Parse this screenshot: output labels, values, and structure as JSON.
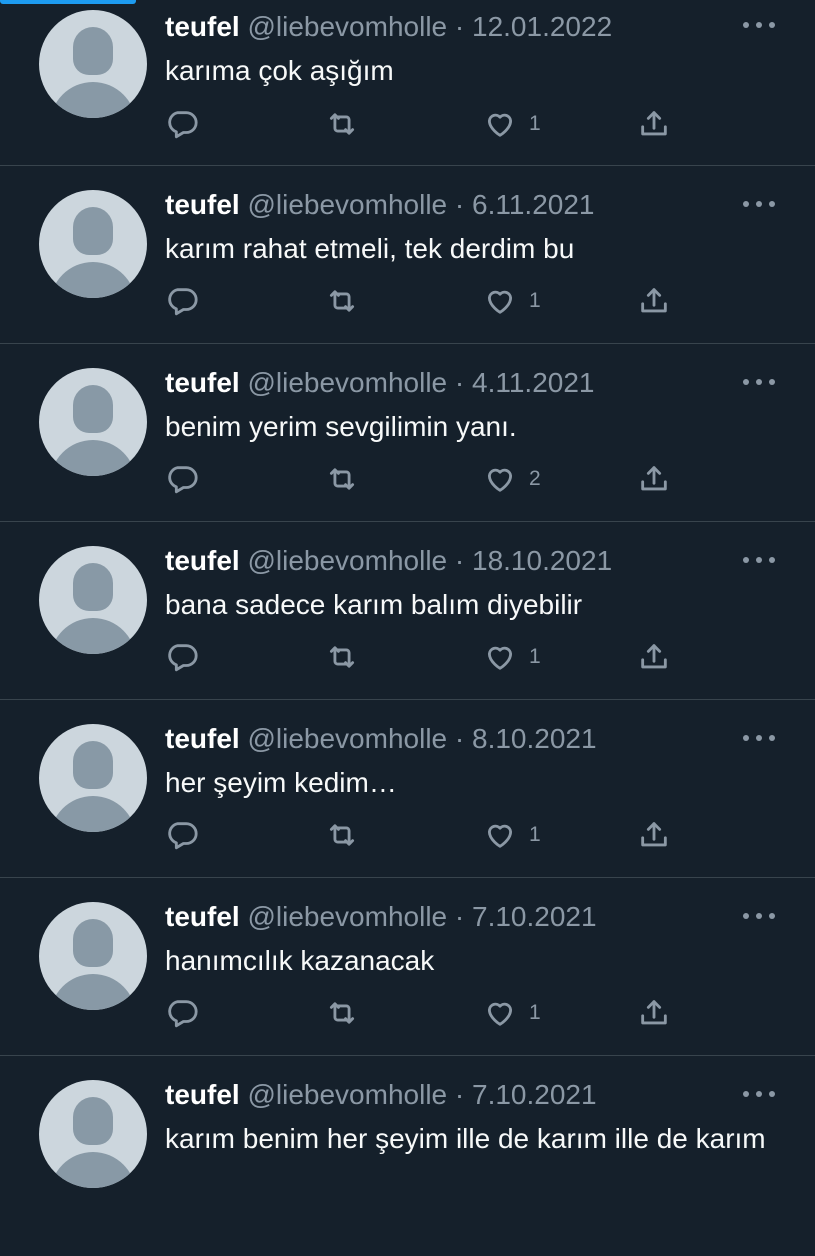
{
  "tweets": [
    {
      "name": "teufel",
      "handle": "@liebevomholle",
      "dot": "·",
      "date": "12.01.2022",
      "text": "karıma çok aşığım",
      "likes": "1"
    },
    {
      "name": "teufel",
      "handle": "@liebevomholle",
      "dot": "·",
      "date": "6.11.2021",
      "text": "karım rahat etmeli, tek derdim bu",
      "likes": "1"
    },
    {
      "name": "teufel",
      "handle": "@liebevomholle",
      "dot": "·",
      "date": "4.11.2021",
      "text": "benim yerim sevgilimin yanı.",
      "likes": "2"
    },
    {
      "name": "teufel",
      "handle": "@liebevomholle",
      "dot": "·",
      "date": "18.10.2021",
      "text": "bana sadece karım balım diyebilir",
      "likes": "1"
    },
    {
      "name": "teufel",
      "handle": "@liebevomholle",
      "dot": "·",
      "date": "8.10.2021",
      "text": "her şeyim kedim…",
      "likes": "1"
    },
    {
      "name": "teufel",
      "handle": "@liebevomholle",
      "dot": "·",
      "date": "7.10.2021",
      "text": "hanımcılık kazanacak",
      "likes": "1"
    },
    {
      "name": "teufel",
      "handle": "@liebevomholle",
      "dot": "·",
      "date": "7.10.2021",
      "text": "karım benim her şeyim ille de karım ille de karım",
      "likes": ""
    }
  ],
  "icons": {
    "reply": "reply-icon",
    "retweet": "retweet-icon",
    "like": "heart-icon",
    "share": "share-icon",
    "more": "more-icon",
    "avatar": "default-avatar"
  },
  "colors": {
    "background": "#15202b",
    "secondary_text": "#8b98a5",
    "divider": "#38444d",
    "accent": "#1d9bf0"
  }
}
